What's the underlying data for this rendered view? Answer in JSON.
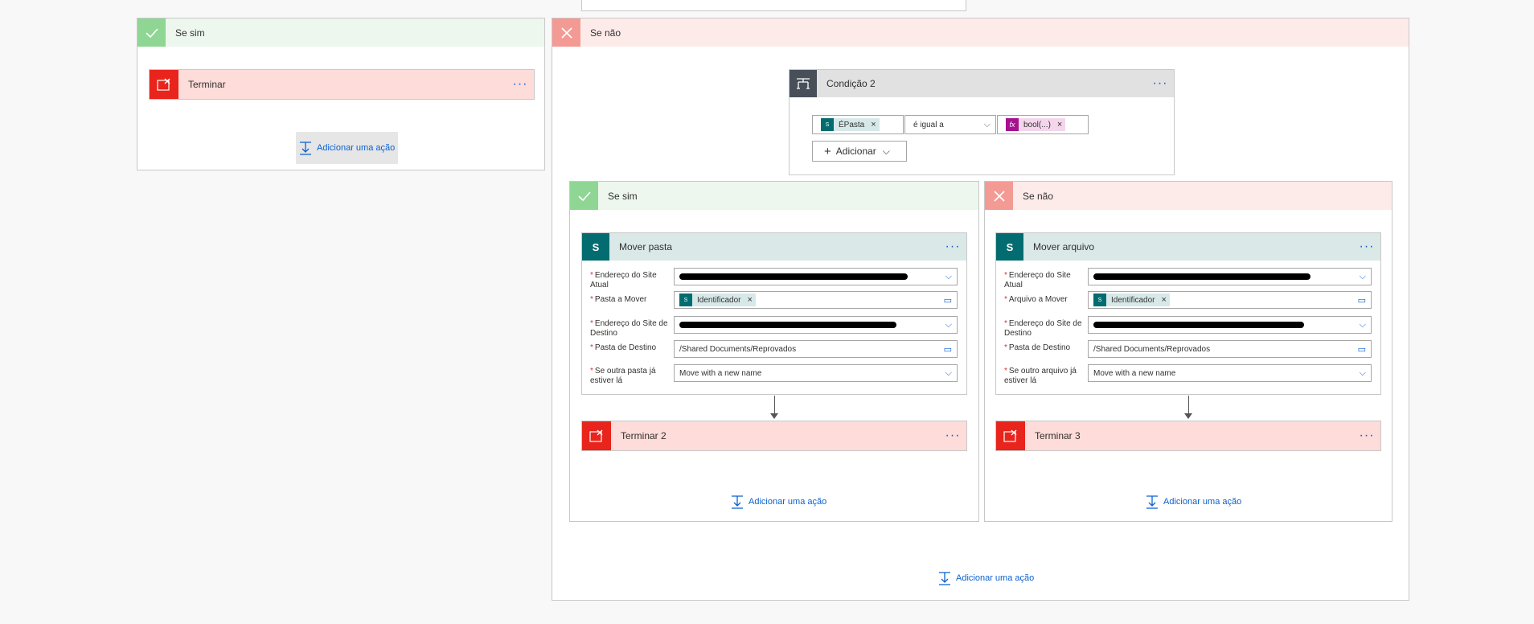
{
  "colors": {
    "accent": "#0b61d0",
    "terminate": "#e8241c",
    "sharepoint": "#036c70",
    "yes": "#8fd694",
    "no": "#f39a95"
  },
  "left_yes": {
    "title": "Se sim",
    "terminate": {
      "title": "Terminar"
    },
    "add_action": "Adicionar uma ação"
  },
  "right_no": {
    "title": "Se não",
    "add_action": "Adicionar uma ação",
    "condition": {
      "title": "Condição 2",
      "left_token": "ÉPasta",
      "operator": "é igual a",
      "right_token": "bool(...)",
      "add_button": "Adicionar"
    },
    "inner_yes": {
      "title": "Se sim",
      "action": {
        "title": "Mover pasta",
        "fields": [
          {
            "label": "Endereço do Site Atual"
          },
          {
            "label": "Pasta a Mover",
            "token": "Identificador"
          },
          {
            "label": "Endereço do Site de Destino"
          },
          {
            "label": "Pasta de Destino",
            "value": "/Shared Documents/Reprovados"
          },
          {
            "label": "Se outra pasta já estiver lá",
            "value": "Move with a new name"
          }
        ]
      },
      "terminate": {
        "title": "Terminar 2"
      },
      "add_action": "Adicionar uma ação"
    },
    "inner_no": {
      "title": "Se não",
      "action": {
        "title": "Mover arquivo",
        "fields": [
          {
            "label": "Endereço do Site Atual"
          },
          {
            "label": "Arquivo a Mover",
            "token": "Identificador"
          },
          {
            "label": "Endereço do Site de Destino"
          },
          {
            "label": "Pasta de Destino",
            "value": "/Shared Documents/Reprovados"
          },
          {
            "label": "Se outro arquivo já estiver lá",
            "value": "Move with a new name"
          }
        ]
      },
      "terminate": {
        "title": "Terminar 3"
      },
      "add_action": "Adicionar uma ação"
    }
  }
}
